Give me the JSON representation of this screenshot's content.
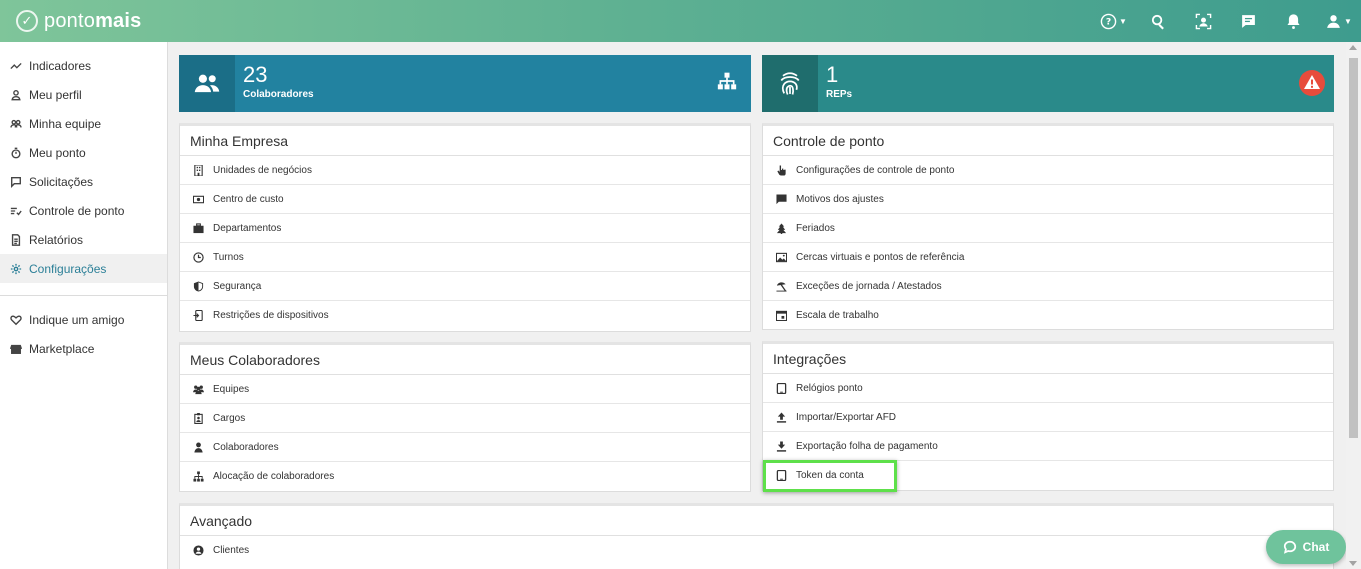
{
  "app": {
    "logo_icon": "check-circle-icon",
    "logo_text": "pontomais",
    "colors": {
      "topbar_start": "#7fc59a",
      "topbar_end": "#3e9c8e",
      "accent": "#2b7f97",
      "highlight": "#5ee04a",
      "chat": "#6fc39c",
      "warning": "#e74c3c"
    }
  },
  "topbar": {
    "icons": [
      "help-icon",
      "search-icon",
      "face-scan-icon",
      "message-icon",
      "bell-icon",
      "user-icon"
    ]
  },
  "sidebar": {
    "items": [
      {
        "label": "Indicadores",
        "icon": "chart-line-icon"
      },
      {
        "label": "Meu perfil",
        "icon": "user-icon"
      },
      {
        "label": "Minha equipe",
        "icon": "team-icon"
      },
      {
        "label": "Meu ponto",
        "icon": "stopwatch-icon"
      },
      {
        "label": "Solicitações",
        "icon": "comment-icon"
      },
      {
        "label": "Controle de ponto",
        "icon": "list-check-icon"
      },
      {
        "label": "Relatórios",
        "icon": "document-icon"
      },
      {
        "label": "Configurações",
        "icon": "gear-icon",
        "active": true
      }
    ],
    "extra": [
      {
        "label": "Indique um amigo",
        "icon": "heart-icon"
      },
      {
        "label": "Marketplace",
        "icon": "store-icon"
      }
    ]
  },
  "stats": {
    "collaborators": {
      "value": "23",
      "label": "Colaboradores",
      "icon": "users-icon",
      "action_icon": "org-chart-icon"
    },
    "reps": {
      "value": "1",
      "label": "REPs",
      "icon": "fingerprint-icon",
      "alert_icon": "warning-icon"
    }
  },
  "cards": {
    "minha_empresa": {
      "title": "Minha Empresa",
      "rows": [
        {
          "label": "Unidades de negócios",
          "icon": "building-icon"
        },
        {
          "label": "Centro de custo",
          "icon": "money-icon"
        },
        {
          "label": "Departamentos",
          "icon": "briefcase-icon"
        },
        {
          "label": "Turnos",
          "icon": "clock-icon"
        },
        {
          "label": "Segurança",
          "icon": "shield-icon"
        },
        {
          "label": "Restrições de dispositivos",
          "icon": "device-lock-icon"
        }
      ]
    },
    "controle_ponto": {
      "title": "Controle de ponto",
      "rows": [
        {
          "label": "Configurações de controle de ponto",
          "icon": "hand-pointer-icon"
        },
        {
          "label": "Motivos dos ajustes",
          "icon": "message-icon"
        },
        {
          "label": "Feriados",
          "icon": "tree-icon"
        },
        {
          "label": "Cercas virtuais e pontos de referência",
          "icon": "map-icon"
        },
        {
          "label": "Exceções de jornada / Atestados",
          "icon": "umbrella-icon"
        },
        {
          "label": "Escala de trabalho",
          "icon": "calendar-icon"
        }
      ]
    },
    "meus_colaboradores": {
      "title": "Meus Colaboradores",
      "rows": [
        {
          "label": "Equipes",
          "icon": "team-icon"
        },
        {
          "label": "Cargos",
          "icon": "badge-icon"
        },
        {
          "label": "Colaboradores",
          "icon": "person-icon"
        },
        {
          "label": "Alocação de colaboradores",
          "icon": "org-chart-icon"
        }
      ]
    },
    "integracoes": {
      "title": "Integrações",
      "rows": [
        {
          "label": "Relógios ponto",
          "icon": "tablet-icon"
        },
        {
          "label": "Importar/Exportar AFD",
          "icon": "upload-icon"
        },
        {
          "label": "Exportação folha de pagamento",
          "icon": "download-icon"
        },
        {
          "label": "Token da conta",
          "icon": "tablet-icon"
        }
      ]
    },
    "avancado": {
      "title": "Avançado",
      "rows": [
        {
          "label": "Clientes",
          "icon": "user-circle-icon"
        }
      ]
    }
  },
  "chat": {
    "label": "Chat",
    "icon": "chat-bubble-icon"
  }
}
